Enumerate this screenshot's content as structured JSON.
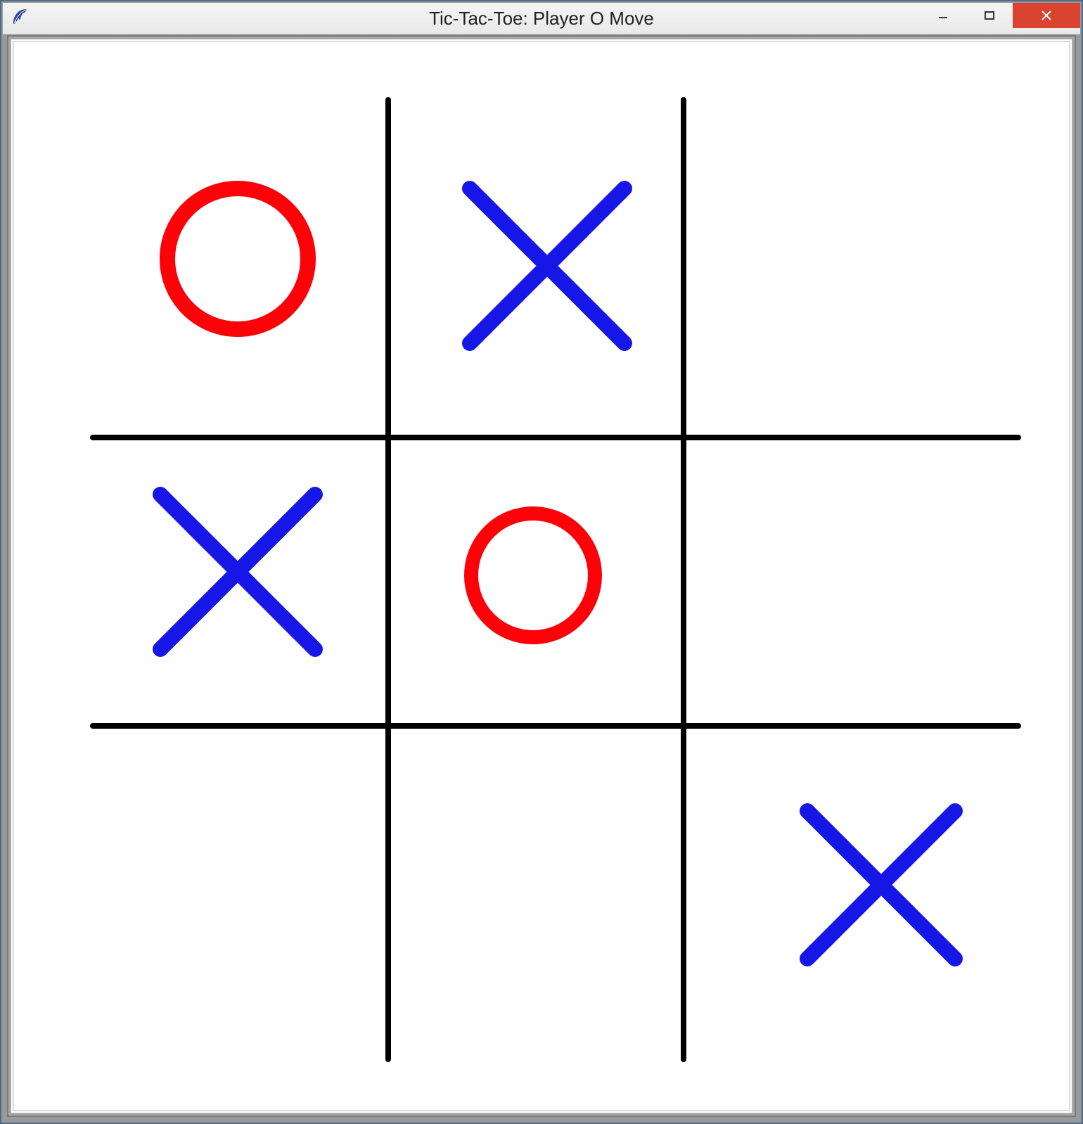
{
  "window": {
    "title": "Tic-Tac-Toe: Player O Move"
  },
  "game": {
    "current_player": "O",
    "grid_size": 3,
    "cells": [
      {
        "row": 0,
        "col": 0,
        "mark": "O"
      },
      {
        "row": 0,
        "col": 1,
        "mark": "X"
      },
      {
        "row": 0,
        "col": 2,
        "mark": ""
      },
      {
        "row": 1,
        "col": 0,
        "mark": "X"
      },
      {
        "row": 1,
        "col": 1,
        "mark": "O"
      },
      {
        "row": 1,
        "col": 2,
        "mark": ""
      },
      {
        "row": 2,
        "col": 0,
        "mark": ""
      },
      {
        "row": 2,
        "col": 1,
        "mark": ""
      },
      {
        "row": 2,
        "col": 2,
        "mark": "X"
      }
    ],
    "colors": {
      "x": "#1616e6",
      "o": "#ff0008",
      "grid": "#000000",
      "canvas_bg": "#ffffff"
    }
  }
}
